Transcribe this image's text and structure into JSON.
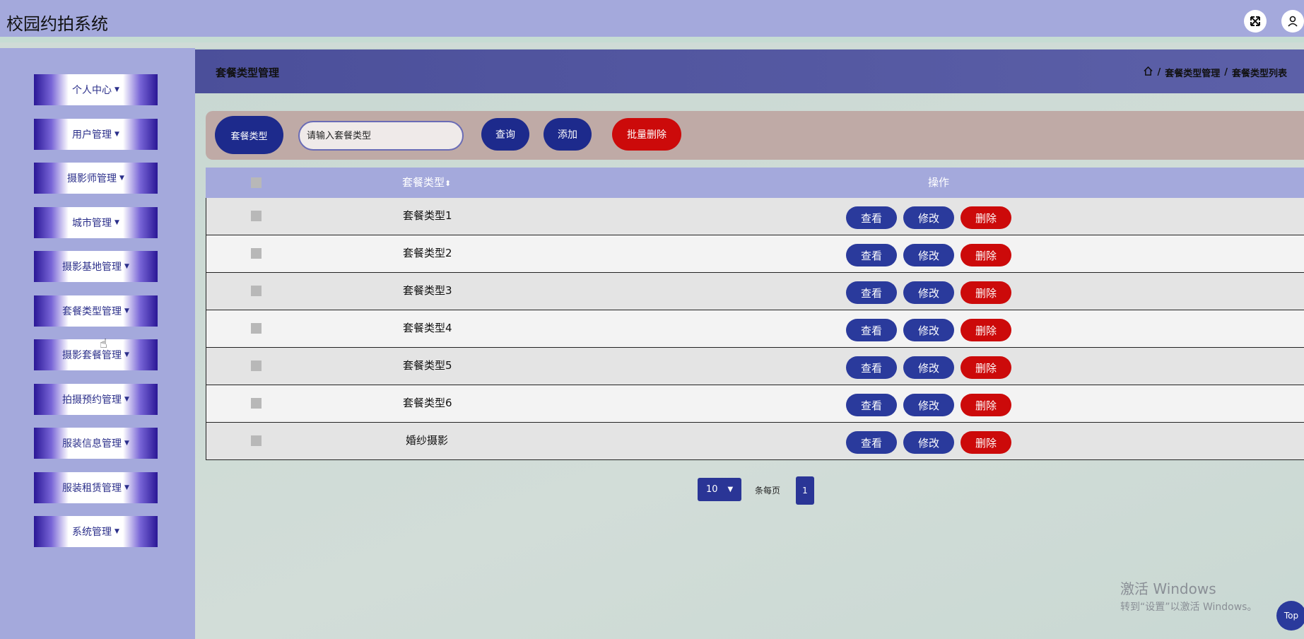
{
  "app": {
    "title": "校园约拍系统"
  },
  "topbar": {
    "fullscreen_icon": "expand-icon",
    "user_icon": "user-icon"
  },
  "sidebar": {
    "items": [
      {
        "label": "个人中心"
      },
      {
        "label": "用户管理"
      },
      {
        "label": "摄影师管理"
      },
      {
        "label": "城市管理"
      },
      {
        "label": "摄影基地管理"
      },
      {
        "label": "套餐类型管理"
      },
      {
        "label": "摄影套餐管理"
      },
      {
        "label": "拍摄预约管理"
      },
      {
        "label": "服装信息管理"
      },
      {
        "label": "服装租赁管理"
      },
      {
        "label": "系统管理"
      }
    ]
  },
  "header": {
    "title": "套餐类型管理",
    "breadcrumb": [
      "套餐类型管理",
      "套餐类型列表"
    ],
    "breadcrumb_sep": "/"
  },
  "search": {
    "label": "套餐类型",
    "placeholder": "请输入套餐类型",
    "query_label": "查询",
    "add_label": "添加",
    "batch_delete_label": "批量删除"
  },
  "table": {
    "columns": [
      "套餐类型",
      "操作"
    ],
    "sort_indicator": "⬍",
    "rows": [
      {
        "name": "套餐类型1"
      },
      {
        "name": "套餐类型2"
      },
      {
        "name": "套餐类型3"
      },
      {
        "name": "套餐类型4"
      },
      {
        "name": "套餐类型5"
      },
      {
        "name": "套餐类型6"
      },
      {
        "name": "婚纱摄影"
      }
    ],
    "actions": {
      "view": "查看",
      "edit": "修改",
      "delete": "删除"
    }
  },
  "pager": {
    "page_size": "10",
    "per_page_label": "条每页",
    "current_page": "1"
  },
  "watermark": {
    "line1": "激活 Windows",
    "line2": "转到“设置”以激活 Windows。"
  },
  "back_to_top": "Top",
  "colors": {
    "primary": "#2a3a9c",
    "danger": "#cc0a0a",
    "topbar": "#a4a9dc"
  }
}
